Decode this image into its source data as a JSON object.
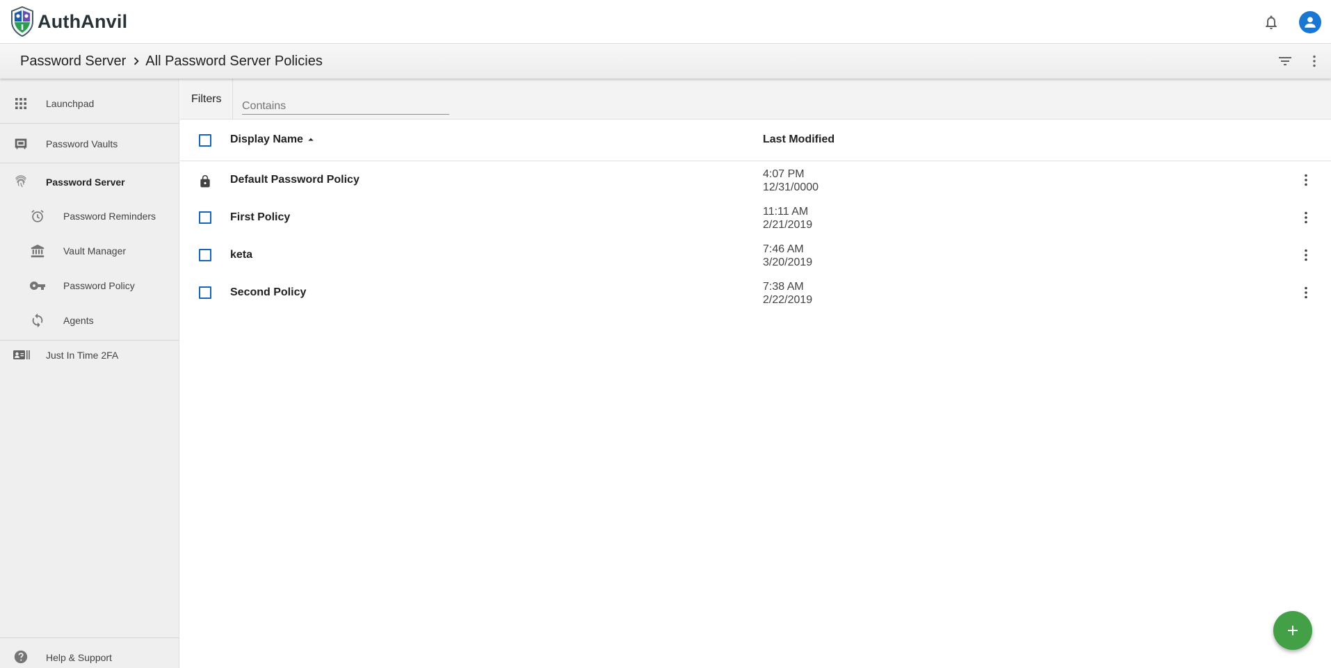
{
  "app": {
    "name": "AuthAnvil"
  },
  "header": {
    "notifications_icon": "bell-icon",
    "account_icon": "account-circle-icon",
    "brand_color": "#1976d2"
  },
  "breadcrumb": {
    "items": [
      "Password Server",
      "All Password Server Policies"
    ],
    "separator_icon": "chevron-right-icon",
    "actions": [
      "filter-icon",
      "more-vert-icon"
    ]
  },
  "sidebar": {
    "items": [
      {
        "label": "Launchpad",
        "icon": "apps-grid-icon",
        "selected": false
      },
      {
        "label": "Password Vaults",
        "icon": "vault-icon",
        "selected": false
      },
      {
        "label": "Password Server",
        "icon": "fingerprint-icon",
        "selected": true
      },
      {
        "label": "Password Reminders",
        "icon": "alarm-icon",
        "selected": false
      },
      {
        "label": "Vault Manager",
        "icon": "bank-icon",
        "selected": false
      },
      {
        "label": "Password Policy",
        "icon": "key-icon",
        "selected": false
      },
      {
        "label": "Agents",
        "icon": "sync-icon",
        "selected": false
      },
      {
        "label": "Just In Time 2FA",
        "icon": "badge-icon",
        "selected": false
      }
    ],
    "footer": {
      "label": "Help & Support",
      "icon": "help-icon"
    }
  },
  "filters": {
    "tab_label": "Filters",
    "placeholder": "Contains",
    "value": ""
  },
  "table": {
    "columns": [
      {
        "label": "Display Name",
        "sort": "ascending"
      },
      {
        "label": "Last Modified"
      }
    ],
    "rows": [
      {
        "name": "Default Password Policy",
        "time": "4:07 PM",
        "date": "12/31/0000",
        "locked": true
      },
      {
        "name": "First Policy",
        "time": "11:11 AM",
        "date": "2/21/2019",
        "locked": false
      },
      {
        "name": "keta",
        "time": "7:46 AM",
        "date": "3/20/2019",
        "locked": false
      },
      {
        "name": "Second Policy",
        "time": "7:38 AM",
        "date": "2/22/2019",
        "locked": false
      }
    ]
  },
  "fab": {
    "icon": "plus-icon",
    "color": "#43a047"
  },
  "colors": {
    "checkbox": "#1565c0",
    "sidebar_bg": "#efefef"
  }
}
